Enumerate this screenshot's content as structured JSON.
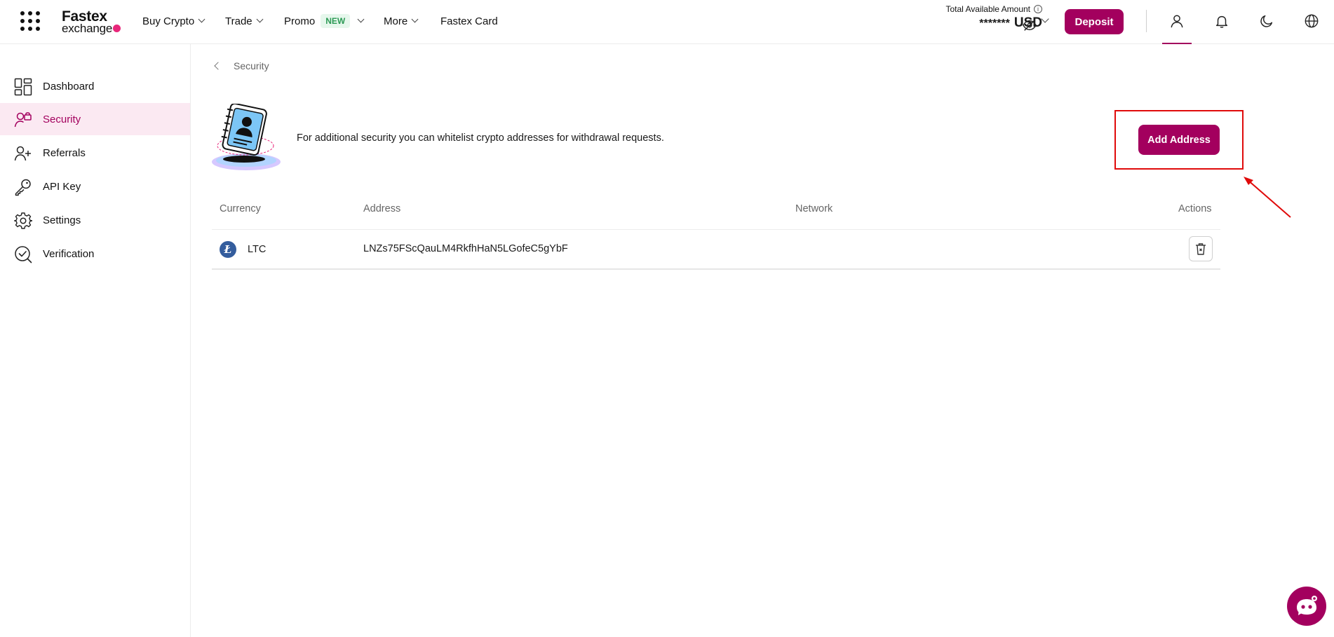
{
  "header": {
    "logo": {
      "line1": "Fastex",
      "line2": "exchange"
    },
    "nav": [
      {
        "label": "Buy Crypto"
      },
      {
        "label": "Trade"
      },
      {
        "label": "Promo",
        "badge": "NEW"
      },
      {
        "label": "More"
      },
      {
        "label": "Fastex Card"
      }
    ],
    "balance": {
      "label": "Total Available Amount",
      "value": "*******",
      "currency": "USD"
    },
    "deposit_label": "Deposit",
    "icons": [
      "apps-grid-icon",
      "user-icon",
      "bell-icon",
      "moon-icon",
      "globe-icon",
      "eye-off-icon",
      "info-icon"
    ]
  },
  "sidebar": {
    "items": [
      {
        "label": "Dashboard",
        "icon": "dashboard-icon"
      },
      {
        "label": "Security",
        "icon": "security-icon",
        "active": true
      },
      {
        "label": "Referrals",
        "icon": "user-plus-icon"
      },
      {
        "label": "API Key",
        "icon": "key-icon"
      },
      {
        "label": "Settings",
        "icon": "gear-icon"
      },
      {
        "label": "Verification",
        "icon": "verify-icon"
      }
    ]
  },
  "main": {
    "breadcrumb": "Security",
    "intro": "For additional security you can whitelist crypto addresses for withdrawal requests.",
    "add_label": "Add Address",
    "table": {
      "columns": [
        "Currency",
        "Address",
        "Network",
        "Actions"
      ],
      "rows": [
        {
          "currency": "LTC",
          "address": "LNZs75FScQauLM4RkfhHaN5LGofeC5gYbF",
          "network": ""
        }
      ]
    }
  },
  "colors": {
    "brand": "#a3005e",
    "highlight": "#e00a0a",
    "active_bg": "#fbe9f2"
  }
}
